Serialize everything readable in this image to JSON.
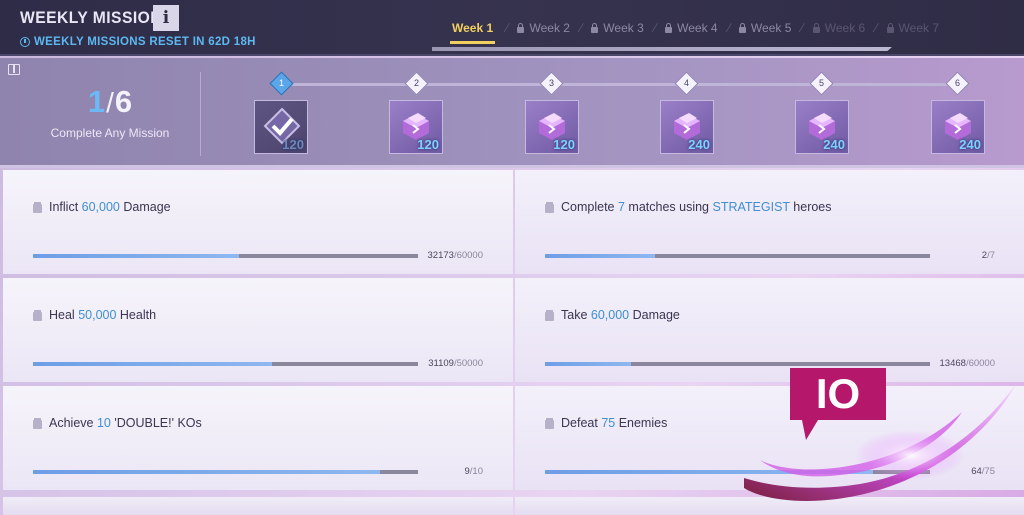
{
  "header": {
    "title": "WEEKLY MISSIONS",
    "info_label": "i",
    "reset_text": "WEEKLY MISSIONS RESET IN 62D 18H"
  },
  "tabs": [
    {
      "label": "Week 1",
      "locked": false,
      "active": true
    },
    {
      "label": "Week 2",
      "locked": true,
      "active": false
    },
    {
      "label": "Week 3",
      "locked": true,
      "active": false
    },
    {
      "label": "Week 4",
      "locked": true,
      "active": false
    },
    {
      "label": "Week 5",
      "locked": true,
      "active": false
    },
    {
      "label": "Week 6",
      "locked": true,
      "active": false
    },
    {
      "label": "Week 7",
      "locked": true,
      "active": false
    }
  ],
  "progress": {
    "completed": "1",
    "total": "6",
    "label": "Complete Any Mission",
    "milestones": [
      {
        "number": "1",
        "amount": "120",
        "claimed": true
      },
      {
        "number": "2",
        "amount": "120",
        "claimed": false
      },
      {
        "number": "3",
        "amount": "120",
        "claimed": false
      },
      {
        "number": "4",
        "amount": "240",
        "claimed": false
      },
      {
        "number": "5",
        "amount": "240",
        "claimed": false
      },
      {
        "number": "6",
        "amount": "240",
        "claimed": false
      }
    ]
  },
  "missions": [
    {
      "pre": "Inflict ",
      "hl": "60,000",
      "post": " Damage",
      "hl2": "",
      "post2": "",
      "current": "32173",
      "target": "/60000",
      "fraction": 0.536
    },
    {
      "pre": "Complete ",
      "hl": "7",
      "post": " matches using ",
      "hl2": "STRATEGIST",
      "post2": " heroes",
      "current": "2",
      "target": "/7",
      "fraction": 0.286
    },
    {
      "pre": "Heal ",
      "hl": "50,000",
      "post": " Health",
      "hl2": "",
      "post2": "",
      "current": "31109",
      "target": "/50000",
      "fraction": 0.622
    },
    {
      "pre": "Take ",
      "hl": "60,000",
      "post": " Damage",
      "hl2": "",
      "post2": "",
      "current": "13468",
      "target": "/60000",
      "fraction": 0.224
    },
    {
      "pre": "Achieve ",
      "hl": "10",
      "post": " 'DOUBLE!' KOs",
      "hl2": "",
      "post2": "",
      "current": "9",
      "target": "/10",
      "fraction": 0.9
    },
    {
      "pre": "Defeat ",
      "hl": "75",
      "post": " Enemies",
      "hl2": "",
      "post2": "",
      "current": "64",
      "target": "/75",
      "fraction": 0.853
    }
  ],
  "colors": {
    "accent_yellow": "#f2d060",
    "highlight_blue": "#3f8fd2",
    "reset_blue": "#5db8f0",
    "logo_magenta": "#c2186f"
  },
  "logo": {
    "text": "IO"
  }
}
